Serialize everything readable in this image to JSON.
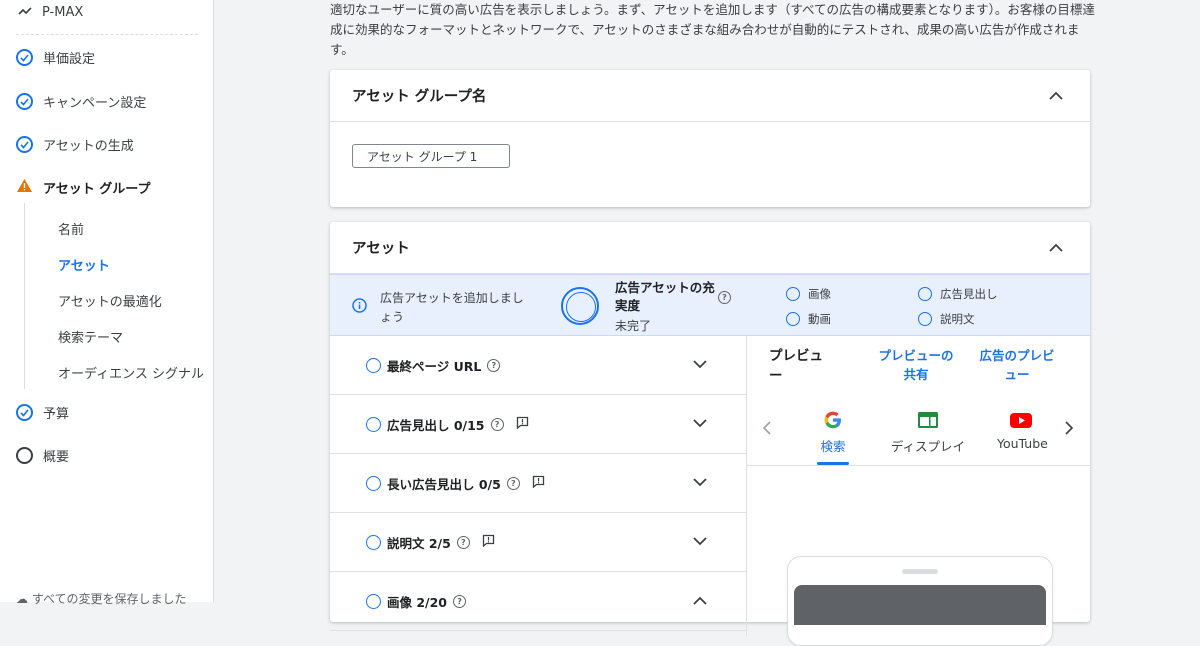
{
  "sidebar": {
    "brand": "P-MAX",
    "items": [
      {
        "label": "単価設定",
        "state": "done"
      },
      {
        "label": "キャンペーン設定",
        "state": "done"
      },
      {
        "label": "アセットの生成",
        "state": "done"
      },
      {
        "label": "アセット グループ",
        "state": "warning"
      },
      {
        "label": "予算",
        "state": "done"
      },
      {
        "label": "概要",
        "state": "empty"
      }
    ],
    "sub_items": [
      "名前",
      "アセット",
      "アセットの最適化",
      "検索テーマ",
      "オーディエンス シグナル"
    ],
    "saved_status": "すべての変更を保存しました"
  },
  "intro_text": "適切なユーザーに質の高い広告を表示しましょう。まず、アセットを追加します（すべての広告の構成要素となります）。お客様の目標達成に効果的なフォーマットとネットワークで、アセットのさまざまな組み合わせが自動的にテストされ、成果の高い広告が作成されます。",
  "group_card": {
    "title": "アセット グループ名",
    "input_value": "アセット グループ 1"
  },
  "asset_card": {
    "title": "アセット",
    "strength_message": "広告アセットを追加しましょう",
    "strength_title": "広告アセットの充実度",
    "strength_value": "未完了",
    "requirements": [
      "画像",
      "広告見出し",
      "動画",
      "説明文"
    ],
    "rows": [
      {
        "label": "最終ページ URL",
        "feedback": false
      },
      {
        "label": "広告見出し 0/15",
        "feedback": true
      },
      {
        "label": "長い広告見出し 0/5",
        "feedback": true
      },
      {
        "label": "説明文 2/5",
        "feedback": true
      },
      {
        "label": "画像 2/20",
        "feedback": false
      }
    ],
    "preview": {
      "title": "プレビュー",
      "share_link": "プレビューの共有",
      "ad_preview_link": "広告のプレビュー",
      "tabs": [
        "検索",
        "ディスプレイ",
        "YouTube"
      ]
    }
  },
  "colors": {
    "accent": "#1a73e8",
    "warning": "#e37400",
    "background": "#f1f3f4"
  }
}
